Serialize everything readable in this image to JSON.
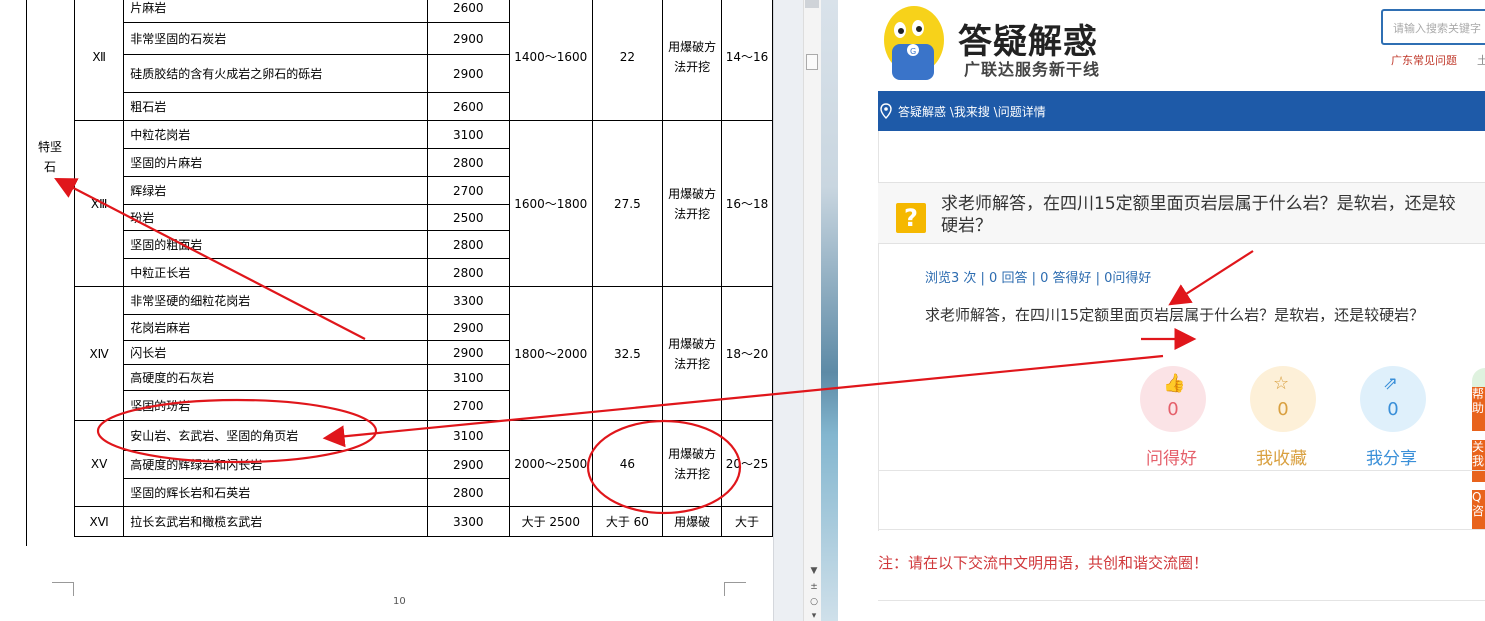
{
  "doc": {
    "side_label": "特坚石",
    "page_number": "10",
    "rows": [
      {
        "level": "Ⅻ",
        "span": 4,
        "name": "片麻岩",
        "density": "2600",
        "strength": "1400～1600",
        "coef": "22",
        "method": "用爆破方法开挖",
        "hard": "14～16"
      },
      {
        "name": "非常坚固的石炭岩",
        "density": "2900"
      },
      {
        "name": "硅质胶结的含有火成岩之卵石的砾岩",
        "density": "2900"
      },
      {
        "name": "粗石岩",
        "density": "2600"
      },
      {
        "level": "ⅩⅢ",
        "span": 6,
        "name": "中粒花岗岩",
        "density": "3100",
        "strength": "1600～1800",
        "coef": "27.5",
        "method": "用爆破方法开挖",
        "hard": "16～18"
      },
      {
        "name": "坚固的片麻岩",
        "density": "2800"
      },
      {
        "name": "辉绿岩",
        "density": "2700"
      },
      {
        "name": "玢岩",
        "density": "2500"
      },
      {
        "name": "坚固的粗面岩",
        "density": "2800"
      },
      {
        "name": "中粒正长岩",
        "density": "2800"
      },
      {
        "level": "ⅩⅣ",
        "span": 5,
        "name": "非常坚硬的细粒花岗岩",
        "density": "3300",
        "strength": "1800～2000",
        "coef": "32.5",
        "method": "用爆破方法开挖",
        "hard": "18～20"
      },
      {
        "name": "花岗岩麻岩",
        "density": "2900"
      },
      {
        "name": "闪长岩",
        "density": "2900"
      },
      {
        "name": "高硬度的石灰岩",
        "density": "3100"
      },
      {
        "name": "坚固的玢岩",
        "density": "2700"
      },
      {
        "level": "ⅩⅤ",
        "span": 3,
        "name": "安山岩、玄武岩、坚固的角页岩",
        "density": "3100",
        "strength": "2000～2500",
        "coef": "46",
        "method": "用爆破方法开挖",
        "hard": "20～25"
      },
      {
        "name": "高硬度的辉绿岩和闪长岩",
        "density": "2900"
      },
      {
        "name": "坚固的辉长岩和石英岩",
        "density": "2800"
      },
      {
        "level": "ⅩⅥ",
        "span": 1,
        "name": "拉长玄武岩和橄榄玄武岩",
        "density": "3300",
        "strength": "大于 2500",
        "coef": "大于 60",
        "method": "用爆破",
        "hard": "大于"
      }
    ]
  },
  "web": {
    "brand_title": "答疑解惑",
    "brand_subtitle": "广联达服务新干线",
    "search_placeholder": "请输入搜索关键字",
    "top_link": "广东常见问题",
    "top_link2": "土",
    "breadcrumb": "答疑解惑 \\我来搜 \\问题详情",
    "question_icon": "?",
    "question_title_line1": "求老师解答，在四川15定额里面页岩层属于什么岩？是软岩，还是较",
    "question_title_line2": "硬岩？",
    "stats": "浏览3 次 | 0 回答 | 0 答得好 | 0问得好",
    "question_body": "求老师解答，在四川15定额里面页岩层属于什么岩？是软岩，还是较硬岩？",
    "actions": [
      {
        "icon": "thumbs-up-icon",
        "glyph": "👍",
        "count": "0",
        "label": "问得好",
        "color": "#e5606b",
        "bg": "#fbe3e6"
      },
      {
        "icon": "star-icon",
        "glyph": "☆",
        "count": "0",
        "label": "我收藏",
        "color": "#d9a040",
        "bg": "#fdf0d8"
      },
      {
        "icon": "share-icon",
        "glyph": "⇗",
        "count": "0",
        "label": "我分享",
        "color": "#3a8fd8",
        "bg": "#dff0fb"
      }
    ],
    "side_tabs": [
      "帮助",
      "关我",
      "Q咨"
    ],
    "notice": "注：请在以下交流中文明用语，共创和谐交流圈！"
  },
  "colors": {
    "annotation_red": "#e0161b",
    "blue_bar": "#1e5aa8",
    "orange_tab": "#e8631c"
  }
}
